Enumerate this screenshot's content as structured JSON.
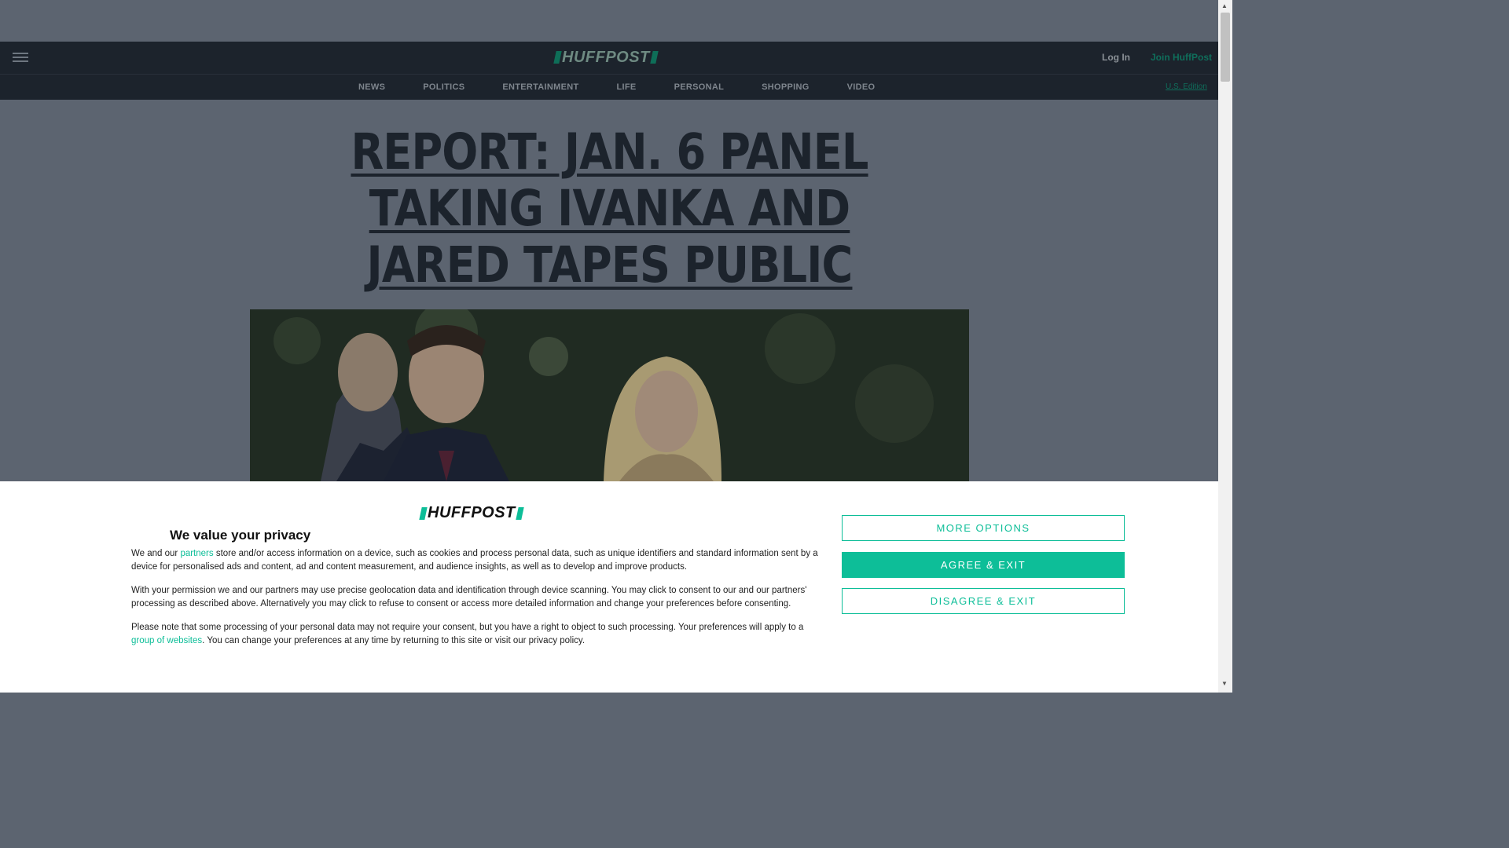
{
  "header": {
    "logo_text": "HUFFPOST",
    "login_label": "Log In",
    "join_label": "Join HuffPost"
  },
  "nav": {
    "items": [
      {
        "label": "NEWS"
      },
      {
        "label": "POLITICS"
      },
      {
        "label": "ENTERTAINMENT"
      },
      {
        "label": "LIFE"
      },
      {
        "label": "PERSONAL"
      },
      {
        "label": "SHOPPING"
      },
      {
        "label": "VIDEO"
      }
    ],
    "edition_label": "U.S. Edition"
  },
  "article": {
    "headline": "REPORT: JAN. 6 PANEL TAKING IVANKA AND JARED TAPES PUBLIC"
  },
  "consent": {
    "logo_text": "HUFFPOST",
    "title": "We value your privacy",
    "p1_before": "We and our ",
    "p1_link": "partners",
    "p1_after": " store and/or access information on a device, such as cookies and process personal data, such as unique identifiers and standard information sent by a device for personalised ads and content, ad and content measurement, and audience insights, as well as to develop and improve products.",
    "p2": "With your permission we and our partners may use precise geolocation data and identification through device scanning. You may click to consent to our and our partners' processing as described above. Alternatively you may click to refuse to consent or access more detailed information and change your preferences before consenting.",
    "p3_before": "Please note that some processing of your personal data may not require your consent, but you have a right to object to such processing. Your preferences will apply to a ",
    "p3_link": "group of websites",
    "p3_after": ". You can change your preferences at any time by returning to this site or visit our privacy policy.",
    "more_options_label": "MORE OPTIONS",
    "agree_label": "AGREE & EXIT",
    "disagree_label": "DISAGREE & EXIT"
  },
  "colors": {
    "brand_green": "#0dbe98",
    "nav_bg": "#1c232c"
  }
}
